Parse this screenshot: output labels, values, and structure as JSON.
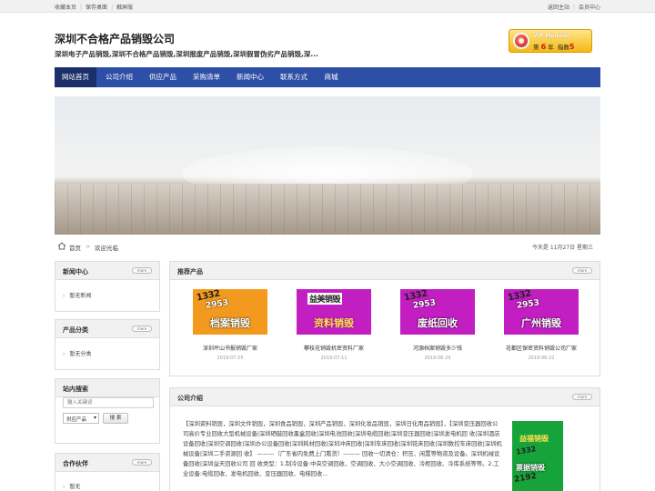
{
  "topbar": {
    "left_links": [
      "收藏本页",
      "保存桌面",
      "触屏版"
    ],
    "right_links": [
      "返回主站",
      "会员中心"
    ]
  },
  "header": {
    "title": "深圳不合格产品销毁公司",
    "subtitle": "深圳电子产品销毁,深圳不合格产品销毁,深圳报废产品销毁,深圳假冒伪劣产品销毁,深..."
  },
  "vip": {
    "label": "VIP Member",
    "year_prefix": "第",
    "year": "6",
    "year_suffix": "年",
    "index_label": "指数",
    "index": "5"
  },
  "nav": {
    "items": [
      "网站首页",
      "公司介绍",
      "供应产品",
      "采购清单",
      "新闻中心",
      "联系方式",
      "商城"
    ]
  },
  "breadcrumb": {
    "home": "首页",
    "separator": ">",
    "current": "欢迎光临",
    "date": "今天是 11月27日 星期三"
  },
  "more_label": "more",
  "sidebar": {
    "news": {
      "title": "新闻中心",
      "empty": "暂无新闻"
    },
    "categories": {
      "title": "产品分类",
      "empty": "暂无分类"
    },
    "search": {
      "title": "站内搜索",
      "placeholder": "输入关键词",
      "scope": "供应产品",
      "button": "搜 索"
    },
    "partners": {
      "title": "合作伙伴",
      "empty": "暂无"
    }
  },
  "products": {
    "title": "推荐产品",
    "items": [
      {
        "digits": "1332",
        "digits2": "2953",
        "tag": "档案销毁",
        "name": "深圳坪山书报销毁厂家",
        "date": "2019-07-25",
        "bg": "#f39a1e",
        "tag_color": "#ffffff"
      },
      {
        "digits": "益美销毁",
        "digits2": "",
        "tag": "资料销毁",
        "name": "攀枝花销毁机密资料厂家",
        "date": "2019-07-11",
        "bg": "#c21ec2",
        "tag_color": "#ffe14d"
      },
      {
        "digits": "1332",
        "digits2": "2953",
        "tag": "废纸回收",
        "name": "河源档案销毁多少钱",
        "date": "2019-06-29",
        "bg": "#c21ec2",
        "tag_color": "#ffffff"
      },
      {
        "digits": "1332",
        "digits2": "2953",
        "tag": "广州销毁",
        "name": "花都区保密资料销毁公司厂家",
        "date": "2019-06-22",
        "bg": "#c21ec2",
        "tag_color": "#ffffff"
      }
    ]
  },
  "about": {
    "title": "公司介绍",
    "text": "【深圳资料销毁，深圳文件销毁，深圳食品销毁，深圳产品销毁，深圳化妆品销毁，深圳日化用品销毁】，【深圳变压器回收公司高价专业回收大型机械设备|深圳硒鼓回收墨盒回收|深圳电池回收|深圳电缆回收|深圳变压器回收|深圳发电机回 收|深圳酒店设备回收|深圳空调回收|深圳办公设备回收|深圳耗材回收|深圳冲床回收|深圳车床回收|深圳铣床回收|深圳数控车床回收|深圳机械设备|深圳二手资源回 收】 ———（广东省内免费上门看货）——— 回收一切清仓：积压、闲置等物资及设备。深圳机械设备回收|深圳益天回收公司 回 收类型：1.制冷设备:中央空调回收、空调回收、大小空调回收、冷柜回收、冷库系统等等。2.工业设备:电缆回收、发电机回收、变压器回收、电梯回收...",
    "pic": {
      "line1": "益福销毁",
      "line2": "1332",
      "line3": "票据销毁",
      "line4": "2192"
    }
  }
}
